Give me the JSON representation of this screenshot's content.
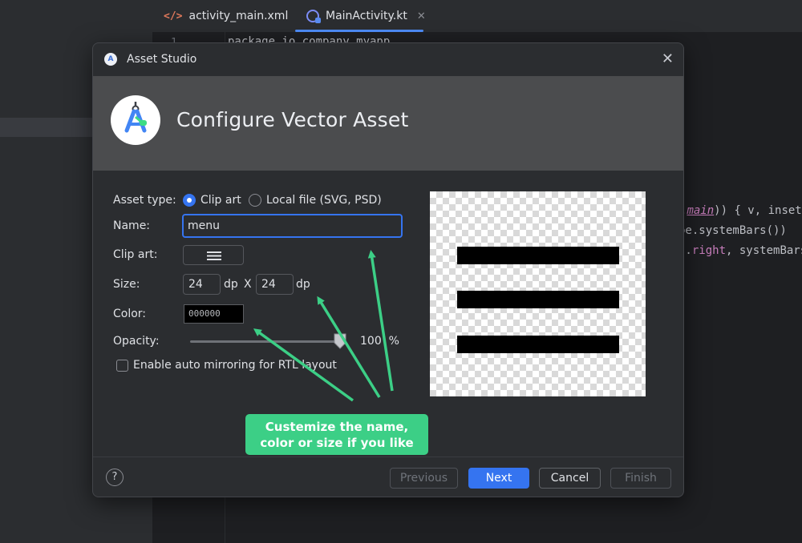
{
  "ide": {
    "tabs": [
      {
        "label": "activity_main.xml"
      },
      {
        "label": "MainActivity.kt"
      }
    ],
    "line_number": "1",
    "code": {
      "line1": "package io.company.myapp",
      "line2_pre": ".",
      "line2_kw": "main",
      "line2_post": ")) { v, insets",
      "line3": "pe.systemBars())",
      "line4_pre": "s.",
      "line4_kw": "right",
      "line4_post": ", systemBars"
    }
  },
  "dialog": {
    "title": "Asset Studio",
    "header_title": "Configure Vector Asset",
    "asset_type": {
      "label": "Asset type:",
      "options": [
        "Clip art",
        "Local file (SVG, PSD)"
      ],
      "selected": "Clip art"
    },
    "name": {
      "label": "Name:",
      "value": "menu"
    },
    "clip_art": {
      "label": "Clip art:"
    },
    "size": {
      "label": "Size:",
      "width": "24",
      "height": "24",
      "unit": "dp",
      "separator": "X"
    },
    "color": {
      "label": "Color:",
      "value": "000000"
    },
    "opacity": {
      "label": "Opacity:",
      "value": "100",
      "unit": "%",
      "level": 1.0
    },
    "rtl_checkbox": {
      "label": "Enable auto mirroring for RTL layout",
      "checked": false
    },
    "buttons": {
      "help": "?",
      "previous": "Previous",
      "next": "Next",
      "cancel": "Cancel",
      "finish": "Finish"
    }
  },
  "annotation": {
    "line1": "Custemize the name,",
    "line2": "color or size if you like"
  },
  "icons": [
    "android-studio-icon",
    "close-icon",
    "menu-icon",
    "help-icon",
    "xml-file-icon",
    "kotlin-file-icon"
  ],
  "colors": {
    "accent": "#3574f0",
    "annotation_green": "#3ccf86",
    "dialog_bg": "#2b2d30",
    "header_bg": "#4b4c4e"
  }
}
